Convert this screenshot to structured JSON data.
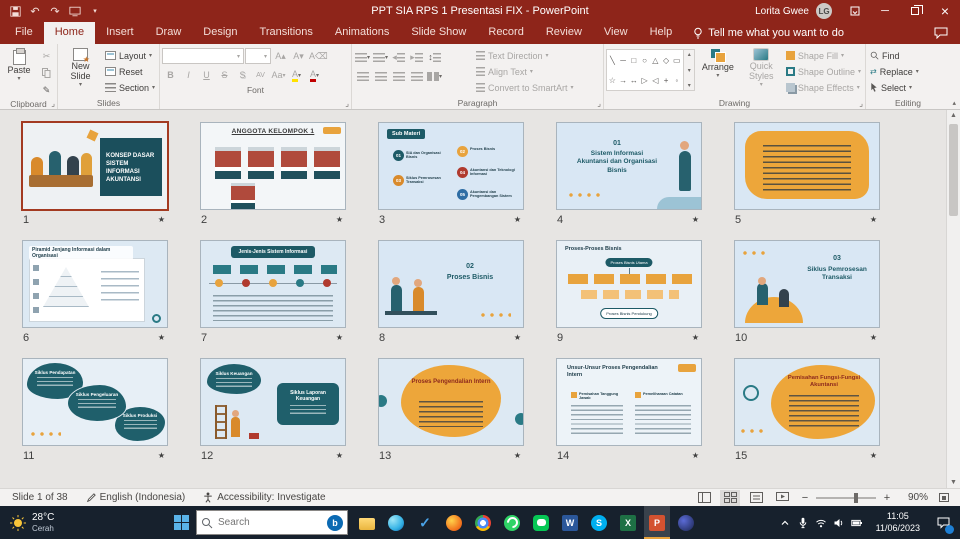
{
  "titlebar": {
    "title": "PPT SIA RPS 1 Presentasi FIX - PowerPoint",
    "user": "Lorita Gwee",
    "avatar": "LG"
  },
  "ribbon": {
    "tabs": [
      "File",
      "Home",
      "Insert",
      "Draw",
      "Design",
      "Transitions",
      "Animations",
      "Slide Show",
      "Record",
      "Review",
      "View",
      "Help"
    ],
    "active_tab": "Home",
    "tell_me": "Tell me what you want to do",
    "groups": {
      "clipboard": {
        "label": "Clipboard",
        "paste": "Paste"
      },
      "slides": {
        "label": "Slides",
        "new_slide": "New Slide",
        "layout": "Layout",
        "reset": "Reset",
        "section": "Section"
      },
      "font": {
        "label": "Font",
        "bold": "B",
        "italic": "I",
        "underline": "U",
        "strike": "S",
        "shadow": "S",
        "spacing": "AV",
        "case": "Aa"
      },
      "paragraph": {
        "label": "Paragraph",
        "text_direction": "Text Direction",
        "align_text": "Align Text",
        "smartart": "Convert to SmartArt"
      },
      "drawing": {
        "label": "Drawing",
        "arrange": "Arrange",
        "quick_styles": "Quick Styles",
        "shape_fill": "Shape Fill",
        "shape_outline": "Shape Outline",
        "shape_effects": "Shape Effects"
      },
      "editing": {
        "label": "Editing",
        "find": "Find",
        "replace": "Replace",
        "select": "Select"
      }
    }
  },
  "slides": [
    {
      "n": 1,
      "selected": true,
      "title": "KONSEP DASAR SISTEM INFORMASI AKUNTANSI"
    },
    {
      "n": 2,
      "title": "ANGGOTA KELOMPOK 1"
    },
    {
      "n": 3,
      "title": "Sub Materi",
      "items": [
        {
          "num": "01",
          "label": "SIA dan Organisasi Bisnis"
        },
        {
          "num": "02",
          "label": "Proses Bisnis"
        },
        {
          "num": "03",
          "label": "Siklus Pemrosesan Transaksi"
        },
        {
          "num": "04",
          "label": "Akuntansi dan Teknologi Informasi"
        },
        {
          "num": "05",
          "label": "Akuntansi dan Pengembangan Sistem"
        }
      ]
    },
    {
      "n": 4,
      "kicker": "01",
      "title": "Sistem Informasi Akuntansi dan Organisasi Bisnis"
    },
    {
      "n": 5
    },
    {
      "n": 6,
      "title": "Piramid Jenjang Informasi dalam Organisasi"
    },
    {
      "n": 7,
      "title": "Jenis-Jenis Sistem Informasi"
    },
    {
      "n": 8,
      "kicker": "02",
      "title": "Proses Bisnis"
    },
    {
      "n": 9,
      "title": "Proses-Proses Bisnis",
      "pills": [
        "Proses Bisnis Utama",
        "Proses Bisnis Pendukung"
      ]
    },
    {
      "n": 10,
      "kicker": "03",
      "title": "Siklus Pemrosesan Transaksi"
    },
    {
      "n": 11,
      "titles": [
        "Siklus Pendapatan",
        "Siklus Pengeluaran",
        "Siklus Produksi"
      ]
    },
    {
      "n": 12,
      "titles": [
        "Siklus Keuangan",
        "Siklus Laporan Keuangan"
      ]
    },
    {
      "n": 13,
      "title": "Proses Pengendalian Intern"
    },
    {
      "n": 14,
      "title": "Unsur-Unsur Proses Pengendalian Intern",
      "items": [
        "Pemisahan Tanggung Jawab",
        "Pemeliharaan Catatan"
      ]
    },
    {
      "n": 15,
      "title": "Pemisahan Fungsi-Fungsi Akuntansi"
    }
  ],
  "statusbar": {
    "slide": "Slide 1 of 38",
    "language": "English (Indonesia)",
    "accessibility": "Accessibility: Investigate",
    "zoom": "90%"
  },
  "taskbar": {
    "weather_temp": "28°C",
    "weather_desc": "Cerah",
    "search_placeholder": "Search",
    "apps": [
      {
        "id": "file-explorer"
      },
      {
        "id": "edge"
      },
      {
        "id": "to-do",
        "letter": "✓"
      },
      {
        "id": "firefox"
      },
      {
        "id": "chrome"
      },
      {
        "id": "whatsapp"
      },
      {
        "id": "line"
      },
      {
        "id": "word",
        "letter": "W"
      },
      {
        "id": "skype",
        "letter": "S"
      },
      {
        "id": "excel",
        "letter": "X"
      },
      {
        "id": "powerpoint",
        "letter": "P",
        "active": true
      },
      {
        "id": "browser"
      }
    ],
    "tray": [
      "chevron-up",
      "mic",
      "wifi",
      "volume",
      "battery"
    ],
    "time": "11:05",
    "date": "11/06/2023"
  }
}
